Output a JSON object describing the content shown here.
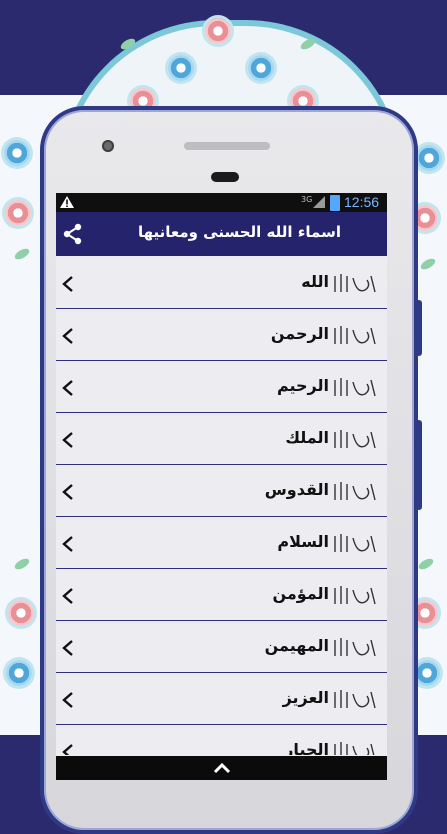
{
  "status_bar": {
    "network_label": "3G",
    "time": "12:56",
    "icons": [
      "warning-icon",
      "signal-icon",
      "battery-icon"
    ]
  },
  "app_bar": {
    "title": "اسماء الله الحسنى ومعانيها",
    "share_icon": "share-icon"
  },
  "names": [
    {
      "label": "الله"
    },
    {
      "label": "الرحمن"
    },
    {
      "label": "الرحيم"
    },
    {
      "label": "الملك"
    },
    {
      "label": "القدوس"
    },
    {
      "label": "السلام"
    },
    {
      "label": "المؤمن"
    },
    {
      "label": "المهيمن"
    },
    {
      "label": "العزيز"
    },
    {
      "label": "الجبار"
    }
  ],
  "bottom_bar": {
    "scroll_up_icon": "chevron-up-icon"
  },
  "colors": {
    "accent": "#26236d",
    "divider": "#2e2f7a",
    "background_frame": "#2b2a6e",
    "screen_bg": "#ececf0"
  }
}
